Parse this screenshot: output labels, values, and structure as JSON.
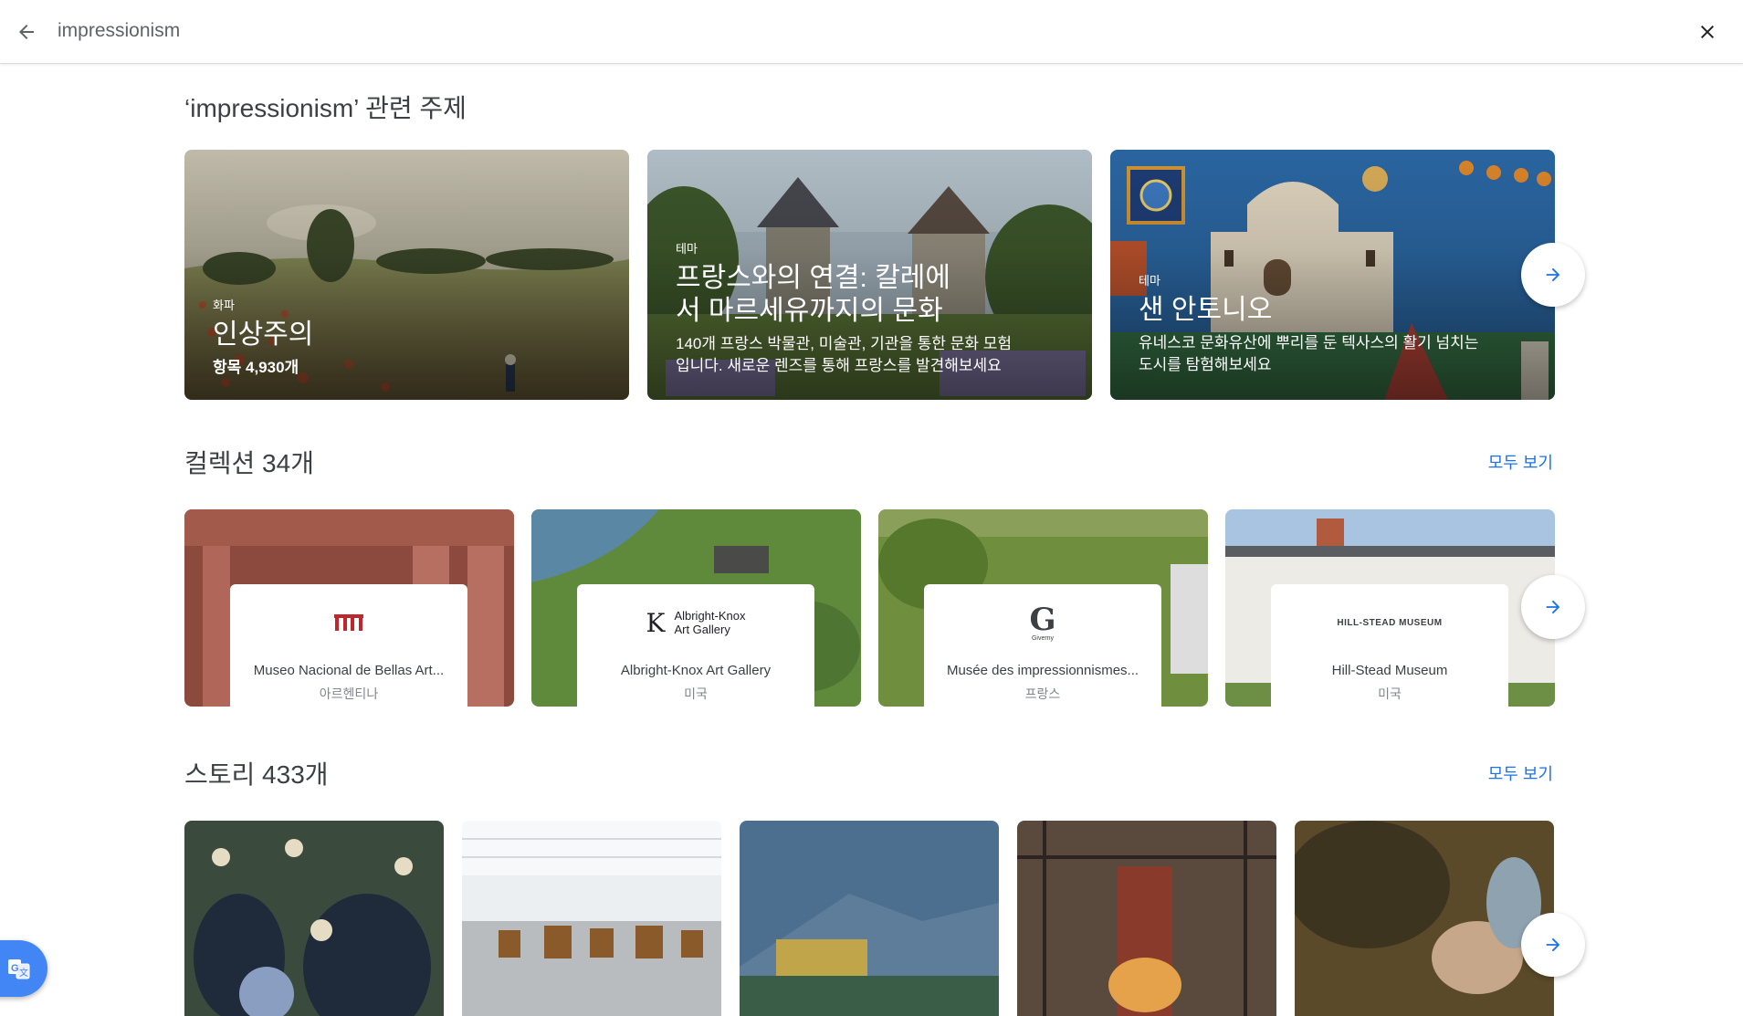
{
  "search": {
    "query": "impressionism"
  },
  "icons": {
    "back": "arrow-back-icon",
    "close": "close-icon",
    "next": "arrow-forward-icon",
    "translate": "translate-icon"
  },
  "colors": {
    "accent": "#1a73e8",
    "translate": "#4285f4"
  },
  "topics_section": {
    "title": "‘impressionism’ 관련 주제",
    "cards": [
      {
        "kicker": "화파",
        "title": "인상주의",
        "subtitle": "항목 4,930개"
      },
      {
        "kicker": "테마",
        "title_line1": "프랑스와의 연결: 칼레에",
        "title_line2": "서 마르세유까지의 문화",
        "desc_line1": "140개 프랑스 박물관, 미술관, 기관을 통한 문화 모험",
        "desc_line2": "입니다. 새로운 렌즈를 통해 프랑스를 발견해보세요"
      },
      {
        "kicker": "테마",
        "title": "샌 안토니오",
        "desc_line1": "유네스코 문화유산에 뿌리를 둔 텍사스의 활기 넘치는",
        "desc_line2": "도시를 탐험해보세요"
      }
    ]
  },
  "collections_section": {
    "title": "컬렉션 34개",
    "see_all": "모두 보기",
    "cards": [
      {
        "name": "Museo Nacional de Bellas Art...",
        "country": "아르헨티나"
      },
      {
        "name": "Albright-Knox Art Gallery",
        "country": "미국",
        "logo_line1": "Albright-Knox",
        "logo_line2": "Art Gallery"
      },
      {
        "name": "Musée des impressionnismes...",
        "country": "프랑스",
        "logo_sub": "Giverny"
      },
      {
        "name": "Hill-Stead Museum",
        "country": "미국",
        "logo_text": "HILL-STEAD MUSEUM"
      }
    ]
  },
  "stories_section": {
    "title": "스토리 433개",
    "see_all": "모두 보기"
  }
}
